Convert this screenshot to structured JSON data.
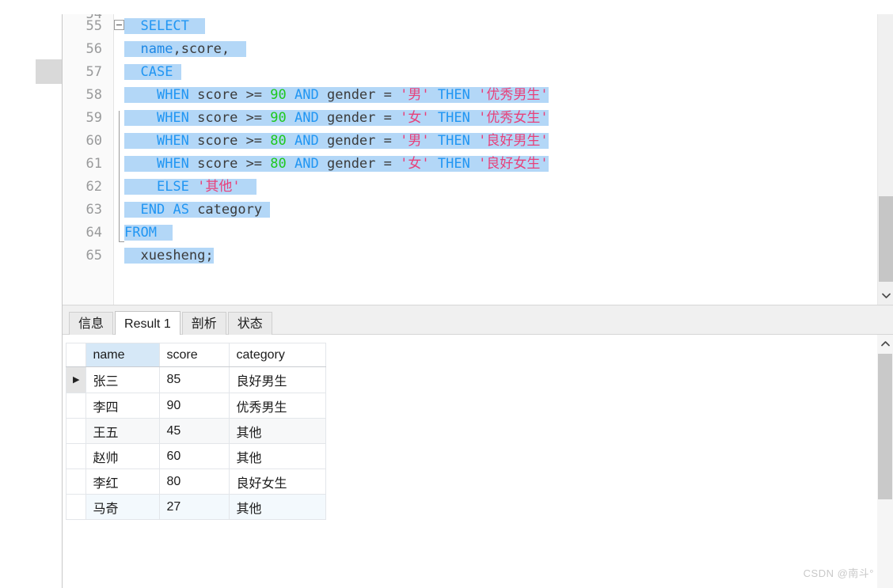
{
  "editor": {
    "first_visible_line_clipped": "54",
    "lines": [
      {
        "num": "55",
        "indent": 0,
        "tokens": [
          {
            "t": "  ",
            "c": "plain",
            "h": true
          },
          {
            "t": "SELECT",
            "c": "kw",
            "h": true
          },
          {
            "t": "  ",
            "c": "plain",
            "h": true
          }
        ]
      },
      {
        "num": "56",
        "indent": 0,
        "tokens": [
          {
            "t": "  ",
            "c": "plain",
            "h": true
          },
          {
            "t": "name",
            "c": "kw2",
            "h": true
          },
          {
            "t": ",",
            "c": "op",
            "h": true
          },
          {
            "t": "score",
            "c": "id",
            "h": true
          },
          {
            "t": ",",
            "c": "op",
            "h": true
          },
          {
            "t": "  ",
            "c": "plain",
            "h": true
          }
        ]
      },
      {
        "num": "57",
        "fold": "minus",
        "tokens": [
          {
            "t": "  ",
            "c": "plain",
            "h": true
          },
          {
            "t": "CASE",
            "c": "kw",
            "h": true
          },
          {
            "t": " ",
            "c": "plain",
            "h": true
          }
        ]
      },
      {
        "num": "58",
        "tokens": [
          {
            "t": "    ",
            "c": "plain",
            "h": true
          },
          {
            "t": "WHEN",
            "c": "kw",
            "h": true
          },
          {
            "t": " score ",
            "c": "id",
            "h": true
          },
          {
            "t": ">=",
            "c": "op",
            "h": true
          },
          {
            "t": " ",
            "c": "plain",
            "h": true
          },
          {
            "t": "90",
            "c": "num",
            "h": true
          },
          {
            "t": " ",
            "c": "plain",
            "h": true
          },
          {
            "t": "AND",
            "c": "kw",
            "h": true
          },
          {
            "t": " gender ",
            "c": "id",
            "h": true
          },
          {
            "t": "=",
            "c": "op",
            "h": true
          },
          {
            "t": " ",
            "c": "plain",
            "h": true
          },
          {
            "t": "'男'",
            "c": "str",
            "h": true
          },
          {
            "t": " ",
            "c": "plain",
            "h": true
          },
          {
            "t": "THEN",
            "c": "kw",
            "h": true
          },
          {
            "t": " ",
            "c": "plain",
            "h": true
          },
          {
            "t": "'优秀男生'",
            "c": "str",
            "h": true
          }
        ]
      },
      {
        "num": "59",
        "tokens": [
          {
            "t": "    ",
            "c": "plain",
            "h": true
          },
          {
            "t": "WHEN",
            "c": "kw",
            "h": true
          },
          {
            "t": " score ",
            "c": "id",
            "h": true
          },
          {
            "t": ">=",
            "c": "op",
            "h": true
          },
          {
            "t": " ",
            "c": "plain",
            "h": true
          },
          {
            "t": "90",
            "c": "num",
            "h": true
          },
          {
            "t": " ",
            "c": "plain",
            "h": true
          },
          {
            "t": "AND",
            "c": "kw",
            "h": true
          },
          {
            "t": " gender ",
            "c": "id",
            "h": true
          },
          {
            "t": "=",
            "c": "op",
            "h": true
          },
          {
            "t": " ",
            "c": "plain",
            "h": true
          },
          {
            "t": "'女'",
            "c": "str",
            "h": true
          },
          {
            "t": " ",
            "c": "plain",
            "h": true
          },
          {
            "t": "THEN",
            "c": "kw",
            "h": true
          },
          {
            "t": " ",
            "c": "plain",
            "h": true
          },
          {
            "t": "'优秀女生'",
            "c": "str",
            "h": true
          }
        ]
      },
      {
        "num": "60",
        "tokens": [
          {
            "t": "    ",
            "c": "plain",
            "h": true
          },
          {
            "t": "WHEN",
            "c": "kw",
            "h": true
          },
          {
            "t": " score ",
            "c": "id",
            "h": true
          },
          {
            "t": ">=",
            "c": "op",
            "h": true
          },
          {
            "t": " ",
            "c": "plain",
            "h": true
          },
          {
            "t": "80",
            "c": "num",
            "h": true
          },
          {
            "t": " ",
            "c": "plain",
            "h": true
          },
          {
            "t": "AND",
            "c": "kw",
            "h": true
          },
          {
            "t": " gender ",
            "c": "id",
            "h": true
          },
          {
            "t": "=",
            "c": "op",
            "h": true
          },
          {
            "t": " ",
            "c": "plain",
            "h": true
          },
          {
            "t": "'男'",
            "c": "str",
            "h": true
          },
          {
            "t": " ",
            "c": "plain",
            "h": true
          },
          {
            "t": "THEN",
            "c": "kw",
            "h": true
          },
          {
            "t": " ",
            "c": "plain",
            "h": true
          },
          {
            "t": "'良好男生'",
            "c": "str",
            "h": true
          }
        ]
      },
      {
        "num": "61",
        "tokens": [
          {
            "t": "    ",
            "c": "plain",
            "h": true
          },
          {
            "t": "WHEN",
            "c": "kw",
            "h": true
          },
          {
            "t": " score ",
            "c": "id",
            "h": true
          },
          {
            "t": ">=",
            "c": "op",
            "h": true
          },
          {
            "t": " ",
            "c": "plain",
            "h": true
          },
          {
            "t": "80",
            "c": "num",
            "h": true
          },
          {
            "t": " ",
            "c": "plain",
            "h": true
          },
          {
            "t": "AND",
            "c": "kw",
            "h": true
          },
          {
            "t": " gender ",
            "c": "id",
            "h": true
          },
          {
            "t": "=",
            "c": "op",
            "h": true
          },
          {
            "t": " ",
            "c": "plain",
            "h": true
          },
          {
            "t": "'女'",
            "c": "str",
            "h": true
          },
          {
            "t": " ",
            "c": "plain",
            "h": true
          },
          {
            "t": "THEN",
            "c": "kw",
            "h": true
          },
          {
            "t": " ",
            "c": "plain",
            "h": true
          },
          {
            "t": "'良好女生'",
            "c": "str",
            "h": true
          }
        ]
      },
      {
        "num": "62",
        "tokens": [
          {
            "t": "    ",
            "c": "plain",
            "h": true
          },
          {
            "t": "ELSE",
            "c": "kw",
            "h": true
          },
          {
            "t": " ",
            "c": "plain",
            "h": true
          },
          {
            "t": "'其他'",
            "c": "str",
            "h": true
          },
          {
            "t": "  ",
            "c": "plain",
            "h": true
          }
        ]
      },
      {
        "num": "63",
        "fold": "end",
        "tokens": [
          {
            "t": "  ",
            "c": "plain",
            "h": true
          },
          {
            "t": "END",
            "c": "kw",
            "h": true
          },
          {
            "t": " ",
            "c": "plain",
            "h": true
          },
          {
            "t": "AS",
            "c": "kw",
            "h": true
          },
          {
            "t": " ",
            "c": "plain",
            "h": true
          },
          {
            "t": "category",
            "c": "id",
            "h": true
          },
          {
            "t": " ",
            "c": "plain",
            "h": true
          }
        ]
      },
      {
        "num": "64",
        "tokens": [
          {
            "t": "FROM",
            "c": "kw",
            "h": true
          },
          {
            "t": "  ",
            "c": "plain",
            "h": true
          }
        ]
      },
      {
        "num": "65",
        "tokens": [
          {
            "t": "  ",
            "c": "plain",
            "h": true
          },
          {
            "t": "xuesheng;",
            "c": "id",
            "h": true
          }
        ]
      }
    ],
    "scrollbar": {
      "down_arrow_icon": "chevron-down-icon"
    }
  },
  "tabbar": {
    "tabs": [
      {
        "label": "信息",
        "active": false
      },
      {
        "label": "Result 1",
        "active": true
      },
      {
        "label": "剖析",
        "active": false
      },
      {
        "label": "状态",
        "active": false
      }
    ]
  },
  "results": {
    "columns": [
      "name",
      "score",
      "category"
    ],
    "selected_column": "name",
    "current_row_index": 0,
    "current_row_marker": "▶",
    "rows": [
      {
        "name": "张三",
        "score": "85",
        "category": "良好男生"
      },
      {
        "name": "李四",
        "score": "90",
        "category": "优秀男生"
      },
      {
        "name": "王五",
        "score": "45",
        "category": "其他"
      },
      {
        "name": "赵帅",
        "score": "60",
        "category": "其他"
      },
      {
        "name": "李红",
        "score": "80",
        "category": "良好女生"
      },
      {
        "name": "马奇",
        "score": "27",
        "category": "其他"
      }
    ],
    "scrollbar": {
      "up_arrow_icon": "chevron-up-icon"
    }
  },
  "watermark": {
    "text": "CSDN @南斗°"
  },
  "colors": {
    "selection": "#b3d7f7",
    "keyword": "#2196f3",
    "number": "#1ec81e",
    "string": "#e8407a",
    "identifier": "#3b3b3b",
    "column_header_selected": "#d6e8f7"
  }
}
